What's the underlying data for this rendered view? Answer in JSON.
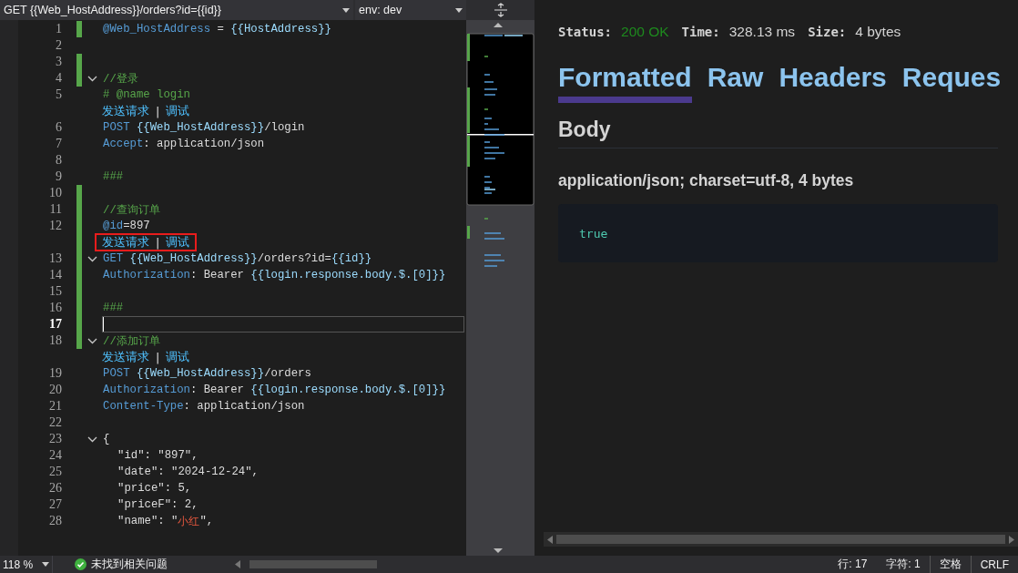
{
  "request_bar": {
    "request": "GET {{Web_HostAddress}}/orders?id={{id}}",
    "environment": "env: dev"
  },
  "editor": {
    "lines": [
      {
        "kind": "code",
        "number": "1",
        "changed": true,
        "fold": false,
        "current": false,
        "tokens": [
          {
            "kind": "name",
            "text": "@Web_HostAddress"
          },
          {
            "kind": "plain",
            "text": " = "
          },
          {
            "kind": "ref",
            "text": "{{HostAddress}}"
          }
        ]
      },
      {
        "kind": "code",
        "number": "2",
        "changed": false,
        "fold": false,
        "current": false
      },
      {
        "kind": "code",
        "number": "3",
        "changed": true,
        "fold": false,
        "current": false
      },
      {
        "kind": "code",
        "number": "4",
        "changed": true,
        "fold": true,
        "current": false,
        "tokens": [
          {
            "kind": "comment",
            "text": "//登录"
          }
        ]
      },
      {
        "kind": "code",
        "number": "5",
        "changed": false,
        "fold": false,
        "current": false,
        "tokens": [
          {
            "kind": "comment",
            "text": "# @name login"
          }
        ]
      },
      {
        "kind": "lens",
        "changed": false,
        "highlighted": false,
        "links": [
          "发送请求",
          "调试"
        ],
        "separator": "|"
      },
      {
        "kind": "code",
        "number": "6",
        "changed": false,
        "fold": false,
        "current": false,
        "tokens": [
          {
            "kind": "name",
            "text": "POST"
          },
          {
            "kind": "ref",
            "text": " {{Web_HostAddress}}"
          },
          {
            "kind": "plain",
            "text": "/login"
          }
        ]
      },
      {
        "kind": "code",
        "number": "7",
        "changed": false,
        "fold": false,
        "current": false,
        "tokens": [
          {
            "kind": "name",
            "text": "Accept"
          },
          {
            "kind": "plain",
            "text": ": application/json"
          }
        ]
      },
      {
        "kind": "code",
        "number": "8",
        "changed": false,
        "fold": false,
        "current": false
      },
      {
        "kind": "code",
        "number": "9",
        "changed": false,
        "fold": false,
        "current": false,
        "tokens": [
          {
            "kind": "comment",
            "text": "###"
          }
        ]
      },
      {
        "kind": "code",
        "number": "10",
        "changed": true,
        "fold": false,
        "current": false
      },
      {
        "kind": "code",
        "number": "11",
        "changed": true,
        "fold": false,
        "current": false,
        "tokens": [
          {
            "kind": "comment",
            "text": "//查询订单"
          }
        ]
      },
      {
        "kind": "code",
        "number": "12",
        "changed": true,
        "fold": false,
        "current": false,
        "tokens": [
          {
            "kind": "name",
            "text": "@id"
          },
          {
            "kind": "plain",
            "text": "=897"
          }
        ]
      },
      {
        "kind": "lens",
        "changed": true,
        "highlighted": true,
        "links": [
          "发送请求",
          "调试"
        ],
        "separator": "|"
      },
      {
        "kind": "code",
        "number": "13",
        "changed": true,
        "fold": true,
        "current": false,
        "tokens": [
          {
            "kind": "name",
            "text": "GET"
          },
          {
            "kind": "ref",
            "text": " {{Web_HostAddress}}"
          },
          {
            "kind": "plain",
            "text": "/orders?id="
          },
          {
            "kind": "ref",
            "text": "{{id}}"
          }
        ]
      },
      {
        "kind": "code",
        "number": "14",
        "changed": true,
        "fold": false,
        "current": false,
        "tokens": [
          {
            "kind": "name",
            "text": "Authorization"
          },
          {
            "kind": "plain",
            "text": ": Bearer "
          },
          {
            "kind": "ref",
            "text": "{{login.response.body.$.[0]}}"
          }
        ]
      },
      {
        "kind": "code",
        "number": "15",
        "changed": true,
        "fold": false,
        "current": false
      },
      {
        "kind": "code",
        "number": "16",
        "changed": true,
        "fold": false,
        "current": false,
        "tokens": [
          {
            "kind": "comment",
            "text": "###"
          }
        ]
      },
      {
        "kind": "code",
        "number": "17",
        "changed": true,
        "fold": false,
        "current": true
      },
      {
        "kind": "code",
        "number": "18",
        "changed": true,
        "fold": true,
        "current": false,
        "tokens": [
          {
            "kind": "comment",
            "text": "//添加订单"
          }
        ]
      },
      {
        "kind": "lens",
        "changed": false,
        "highlighted": false,
        "links": [
          "发送请求",
          "调试"
        ],
        "separator": "|"
      },
      {
        "kind": "code",
        "number": "19",
        "changed": false,
        "fold": false,
        "current": false,
        "tokens": [
          {
            "kind": "name",
            "text": "POST"
          },
          {
            "kind": "ref",
            "text": " {{Web_HostAddress}}"
          },
          {
            "kind": "plain",
            "text": "/orders"
          }
        ]
      },
      {
        "kind": "code",
        "number": "20",
        "changed": false,
        "fold": false,
        "current": false,
        "tokens": [
          {
            "kind": "name",
            "text": "Authorization"
          },
          {
            "kind": "plain",
            "text": ": Bearer "
          },
          {
            "kind": "ref",
            "text": "{{login.response.body.$.[0]}}"
          }
        ]
      },
      {
        "kind": "code",
        "number": "21",
        "changed": false,
        "fold": false,
        "current": false,
        "tokens": [
          {
            "kind": "name",
            "text": "Content-Type"
          },
          {
            "kind": "plain",
            "text": ": application/json"
          }
        ]
      },
      {
        "kind": "code",
        "number": "22",
        "changed": false,
        "fold": false,
        "current": false
      },
      {
        "kind": "code",
        "number": "23",
        "changed": false,
        "fold": true,
        "current": false,
        "indented": false,
        "tokens": [
          {
            "kind": "plain",
            "text": "{"
          }
        ]
      },
      {
        "kind": "code",
        "number": "24",
        "changed": false,
        "fold": false,
        "current": false,
        "indented": true,
        "tokens": [
          {
            "kind": "plain",
            "text": "\"id\": \"897\","
          }
        ]
      },
      {
        "kind": "code",
        "number": "25",
        "changed": false,
        "fold": false,
        "current": false,
        "indented": true,
        "tokens": [
          {
            "kind": "plain",
            "text": "\"date\": \"2024-12-24\","
          }
        ]
      },
      {
        "kind": "code",
        "number": "26",
        "changed": false,
        "fold": false,
        "current": false,
        "indented": true,
        "tokens": [
          {
            "kind": "plain",
            "text": "\"price\": 5,"
          }
        ]
      },
      {
        "kind": "code",
        "number": "27",
        "changed": false,
        "fold": false,
        "current": false,
        "indented": true,
        "tokens": [
          {
            "kind": "plain",
            "text": "\"priceF\": 2,"
          }
        ]
      },
      {
        "kind": "code",
        "number": "28",
        "changed": false,
        "fold": false,
        "current": false,
        "indented": true,
        "tokens": [
          {
            "kind": "plain",
            "text": "\"name\": \""
          },
          {
            "kind": "string",
            "text": "小红"
          },
          {
            "kind": "plain",
            "text": "\","
          }
        ]
      }
    ]
  },
  "response": {
    "summary": [
      {
        "label": "Status:",
        "value": "200 OK",
        "kind": "success"
      },
      {
        "label": "Time:",
        "value": "328.13 ms",
        "kind": "plain"
      },
      {
        "label": "Size:",
        "value": "4 bytes",
        "kind": "plain"
      }
    ],
    "tabs": [
      {
        "label": "Formatted",
        "selected": true
      },
      {
        "label": "Raw",
        "selected": false
      },
      {
        "label": "Headers",
        "selected": false
      },
      {
        "label": "Reques",
        "selected": false
      }
    ],
    "section_title": "Body",
    "content_type": "application/json; charset=utf-8, 4 bytes",
    "body": "true"
  },
  "status_bar": {
    "zoom": "118 %",
    "issues": "未找到相关问题",
    "line": "行: 17",
    "column": "字符: 1",
    "indentation": "空格",
    "line_ending": "CRLF"
  }
}
